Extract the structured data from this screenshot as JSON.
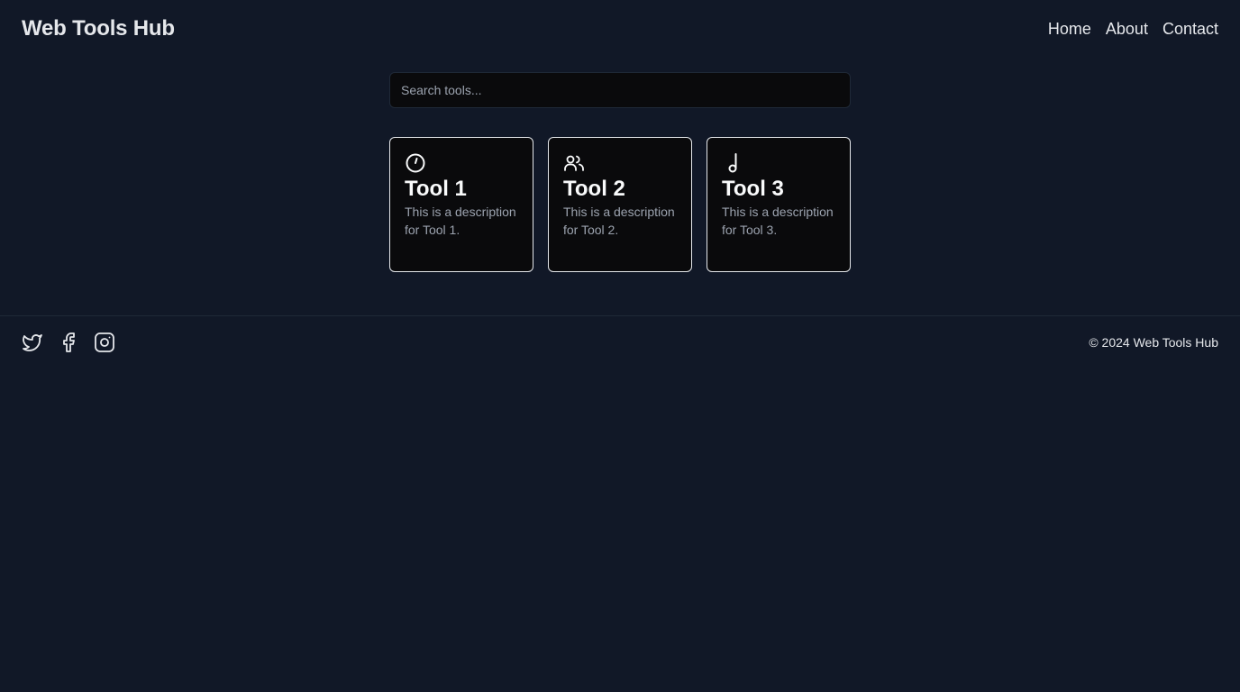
{
  "header": {
    "brand": "Web Tools Hub",
    "nav": [
      {
        "label": "Home"
      },
      {
        "label": "About"
      },
      {
        "label": "Contact"
      }
    ]
  },
  "search": {
    "placeholder": "Search tools...",
    "value": ""
  },
  "tools": [
    {
      "icon": "timer-icon",
      "title": "Tool 1",
      "description": "This is a description for Tool 1."
    },
    {
      "icon": "users-icon",
      "title": "Tool 2",
      "description": "This is a description for Tool 2."
    },
    {
      "icon": "music-note-icon",
      "title": "Tool 3",
      "description": "This is a description for Tool 3."
    }
  ],
  "footer": {
    "socials": [
      {
        "icon": "twitter-icon"
      },
      {
        "icon": "facebook-icon"
      },
      {
        "icon": "instagram-icon"
      }
    ],
    "copyright": "© 2024 Web Tools Hub"
  },
  "colors": {
    "background": "#111827",
    "card_background": "#0a0a0c",
    "card_border": "#e5e7eb",
    "text_primary": "#e5e7eb",
    "text_muted": "#9ca3af"
  }
}
